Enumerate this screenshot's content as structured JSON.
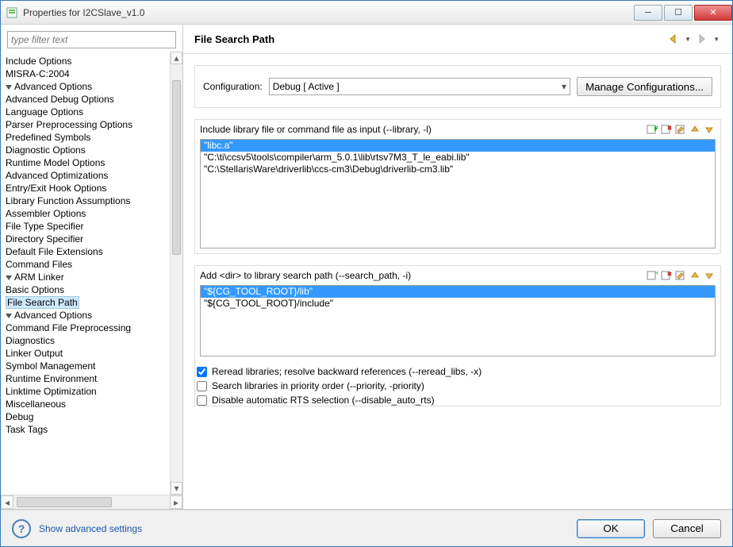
{
  "window": {
    "title": "Properties for I2CSlave_v1.0"
  },
  "filter": {
    "placeholder": "type filter text"
  },
  "tree": {
    "items": [
      {
        "label": "Include Options",
        "indent": "ind2"
      },
      {
        "label": "MISRA-C:2004",
        "indent": "ind2"
      },
      {
        "label": "Advanced Options",
        "indent": "ind2",
        "disc": "open"
      },
      {
        "label": "Advanced Debug Options",
        "indent": "ind3"
      },
      {
        "label": "Language Options",
        "indent": "ind3"
      },
      {
        "label": "Parser Preprocessing Options",
        "indent": "ind3"
      },
      {
        "label": "Predefined Symbols",
        "indent": "ind3"
      },
      {
        "label": "Diagnostic Options",
        "indent": "ind3"
      },
      {
        "label": "Runtime Model Options",
        "indent": "ind3"
      },
      {
        "label": "Advanced Optimizations",
        "indent": "ind3"
      },
      {
        "label": "Entry/Exit Hook Options",
        "indent": "ind3"
      },
      {
        "label": "Library Function Assumptions",
        "indent": "ind3"
      },
      {
        "label": "Assembler Options",
        "indent": "ind3"
      },
      {
        "label": "File Type Specifier",
        "indent": "ind3"
      },
      {
        "label": "Directory Specifier",
        "indent": "ind3"
      },
      {
        "label": "Default File Extensions",
        "indent": "ind3"
      },
      {
        "label": "Command Files",
        "indent": "ind3"
      },
      {
        "label": "ARM Linker",
        "indent": "ind1",
        "disc": "open"
      },
      {
        "label": "Basic Options",
        "indent": "ind2"
      },
      {
        "label": "File Search Path",
        "indent": "ind2",
        "selected": true
      },
      {
        "label": "Advanced Options",
        "indent": "ind2",
        "disc": "open"
      },
      {
        "label": "Command File Preprocessing",
        "indent": "ind3"
      },
      {
        "label": "Diagnostics",
        "indent": "ind3"
      },
      {
        "label": "Linker Output",
        "indent": "ind3"
      },
      {
        "label": "Symbol Management",
        "indent": "ind3"
      },
      {
        "label": "Runtime Environment",
        "indent": "ind3"
      },
      {
        "label": "Linktime Optimization",
        "indent": "ind3"
      },
      {
        "label": "Miscellaneous",
        "indent": "ind3"
      },
      {
        "label": "Debug",
        "indent": "ind0a"
      },
      {
        "label": "Task Tags",
        "indent": "ind0a"
      }
    ]
  },
  "page": {
    "title": "File Search Path",
    "config_label": "Configuration:",
    "config_value": "Debug  [ Active ]",
    "manage_btn": "Manage Configurations..."
  },
  "list1": {
    "label": "Include library file or command file as input (--library, -l)",
    "items": [
      "\"libc.a\"",
      "\"C:\\ti\\ccsv5\\tools\\compiler\\arm_5.0.1\\lib\\rtsv7M3_T_le_eabi.lib\"",
      "\"C:\\StellarisWare\\driverlib\\ccs-cm3\\Debug\\driverlib-cm3.lib\""
    ],
    "selected": 0
  },
  "list2": {
    "label": "Add <dir> to library search path (--search_path, -i)",
    "items": [
      "\"${CG_TOOL_ROOT}/lib\"",
      "\"${CG_TOOL_ROOT}/include\""
    ],
    "selected": 0
  },
  "checks": {
    "reread": {
      "label": "Reread libraries; resolve backward references (--reread_libs, -x)",
      "checked": true
    },
    "priority": {
      "label": "Search libraries in priority order (--priority, -priority)",
      "checked": false
    },
    "disable_rts": {
      "label": "Disable automatic RTS selection (--disable_auto_rts)",
      "checked": false
    }
  },
  "footer": {
    "show_advanced": "Show advanced settings",
    "ok": "OK",
    "cancel": "Cancel"
  }
}
